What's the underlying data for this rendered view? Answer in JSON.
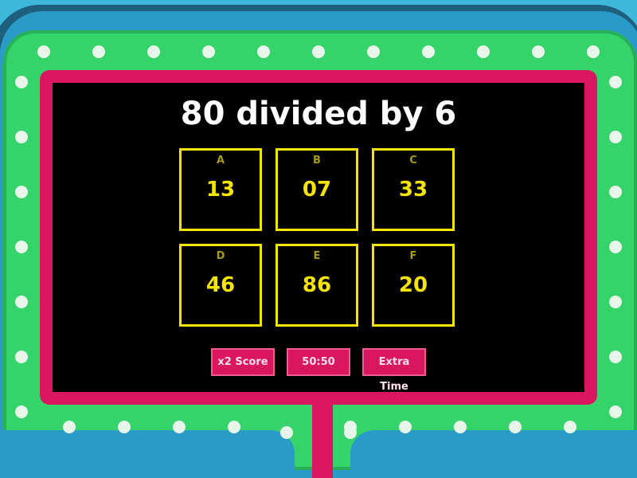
{
  "question": "80 divided by 6",
  "answers": [
    {
      "letter": "A",
      "value": "13"
    },
    {
      "letter": "B",
      "value": "07"
    },
    {
      "letter": "C",
      "value": "33"
    },
    {
      "letter": "D",
      "value": "46"
    },
    {
      "letter": "E",
      "value": "86"
    },
    {
      "letter": "F",
      "value": "20"
    }
  ],
  "powerups": {
    "double": "x2 Score",
    "fifty": "50:50",
    "time": "Extra Time"
  },
  "colors": {
    "background": "#3fb7da",
    "green_frame": "#35d46a",
    "pink_frame": "#d8175f",
    "answer_border": "#f4e400",
    "question_text": "#ffffff",
    "lights": "#e8f5ea"
  }
}
